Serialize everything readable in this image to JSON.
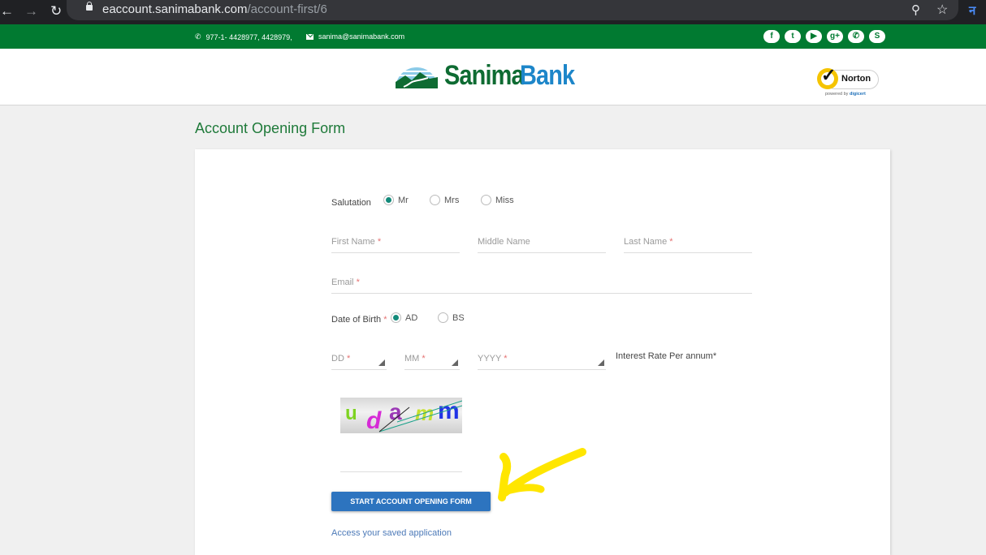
{
  "browser": {
    "url_host": "eaccount.sanimabank.com",
    "url_path": "/account-first/6",
    "icons": [
      "back-icon",
      "forward-icon",
      "reload-icon",
      "lock-icon",
      "zoom-icon",
      "bookmark-star-icon",
      "extension-icon"
    ]
  },
  "topbar": {
    "phone": "977-1- 4428977, 4428979,",
    "email": "sanima@sanimabank.com",
    "socials": [
      {
        "name": "facebook",
        "glyph": "f"
      },
      {
        "name": "twitter",
        "glyph": "t"
      },
      {
        "name": "youtube",
        "glyph": "▶"
      },
      {
        "name": "google-plus",
        "glyph": "g+"
      },
      {
        "name": "viber",
        "glyph": "✆"
      },
      {
        "name": "skype",
        "glyph": "S"
      }
    ]
  },
  "header": {
    "brand_part1": "Sanima",
    "brand_part2": "Bank",
    "norton_label": "Norton",
    "norton_sub_prefix": "powered by ",
    "norton_sub_brand": "digicert"
  },
  "page": {
    "title": "Account Opening Form"
  },
  "form": {
    "salutation_label": "Salutation",
    "salutation_options": [
      {
        "label": "Mr",
        "selected": true
      },
      {
        "label": "Mrs",
        "selected": false
      },
      {
        "label": "Miss",
        "selected": false
      }
    ],
    "first_name": {
      "placeholder": "First Name",
      "required": "*",
      "value": ""
    },
    "middle_name": {
      "placeholder": "Middle Name",
      "value": ""
    },
    "last_name": {
      "placeholder": "Last Name",
      "required": "*",
      "value": ""
    },
    "email": {
      "placeholder": "Email",
      "required": "*",
      "value": ""
    },
    "dob_label": "Date of Birth",
    "dob_required": "*",
    "dob_options": [
      {
        "label": "AD",
        "selected": true
      },
      {
        "label": "BS",
        "selected": false
      }
    ],
    "dd": {
      "placeholder": "DD",
      "required": "*"
    },
    "mm": {
      "placeholder": "MM",
      "required": "*"
    },
    "yyyy": {
      "placeholder": "YYYY",
      "required": "*"
    },
    "interest_label": "Interest Rate Per annum*",
    "captcha_text": "udamm",
    "captcha_value": "",
    "start_button": "START ACCOUNT OPENING FORM",
    "saved_link": "Access your saved application"
  },
  "annotation": {
    "color": "#ffe600",
    "shape": "hand-drawn-arrow"
  }
}
